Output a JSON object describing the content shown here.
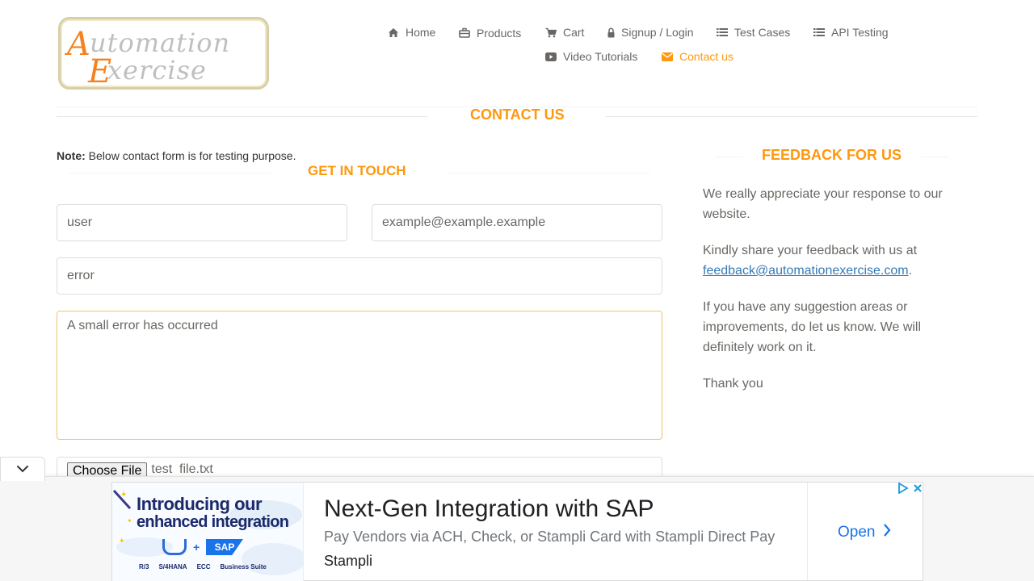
{
  "header": {
    "logo_text_line1": "Automation",
    "logo_text_line2": "Exercise",
    "nav": [
      {
        "label": "Home",
        "icon": "home-icon"
      },
      {
        "label": "Products",
        "icon": "briefcase-icon"
      },
      {
        "label": "Cart",
        "icon": "cart-icon"
      },
      {
        "label": "Signup / Login",
        "icon": "lock-icon"
      },
      {
        "label": "Test Cases",
        "icon": "list-icon"
      },
      {
        "label": "API Testing",
        "icon": "list-icon"
      },
      {
        "label": "Video Tutorials",
        "icon": "youtube-icon"
      },
      {
        "label": "Contact us",
        "icon": "envelope-icon",
        "active": true
      }
    ]
  },
  "page": {
    "title": "Contact Us"
  },
  "contact_form": {
    "note_bold": "Note:",
    "note_text": "Below contact form is for testing purpose.",
    "title": "Get In Touch",
    "name_value": "user",
    "email_value": "example@example.example",
    "subject_value": "error",
    "message_value": "A small error has occurred",
    "file_button": "Choose File",
    "file_name": "test  file.txt"
  },
  "feedback": {
    "title": "Feedback For Us",
    "para1": "We really appreciate your response to our website.",
    "para2_prefix": "Kindly share your feedback with us at",
    "email": "feedback@automationexercise.com",
    "para2_suffix": ".",
    "para3": "If you have any suggestion areas or improvements, do let us know. We will definitely work on it.",
    "para4": "Thank you"
  },
  "ad": {
    "image_line1": "Introducing our",
    "image_line2": "enhanced integration",
    "image_tags": [
      "R/3",
      "S/4HANA",
      "ECC",
      "Business Suite"
    ],
    "image_sap": "SAP",
    "headline": "Next-Gen Integration with SAP",
    "description": "Pay Vendors via ACH, Check, or Stampli Card with Stampli Direct Pay",
    "brand": "Stampli",
    "cta": "Open"
  },
  "colors": {
    "accent": "#fe980f",
    "text": "#696763",
    "link": "#337ab7",
    "ad_link": "#1a73e8"
  }
}
